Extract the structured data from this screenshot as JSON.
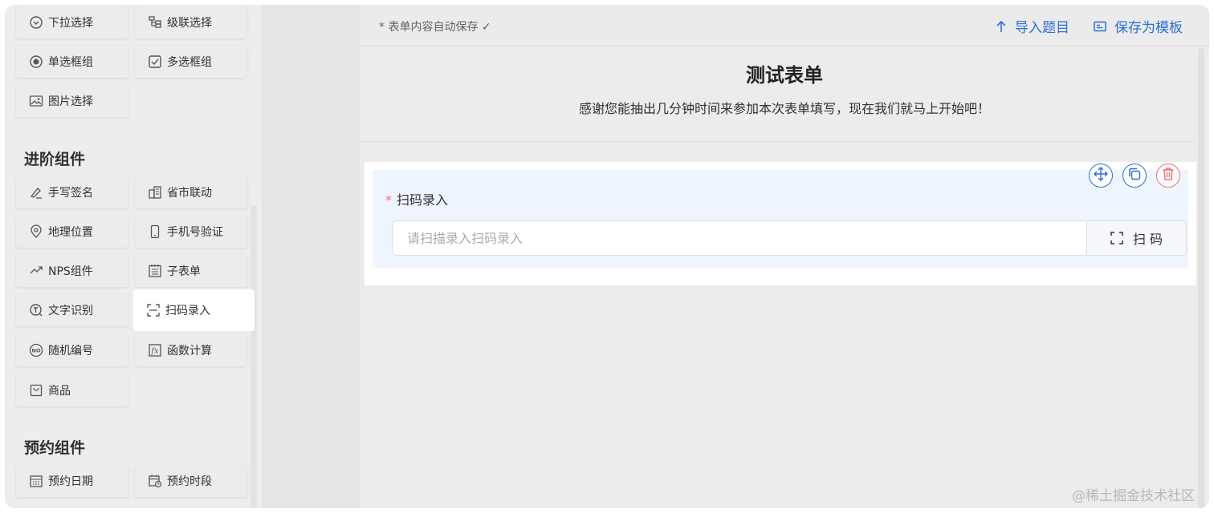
{
  "palette": {
    "basic_items": [
      {
        "label": "下拉选择",
        "icon": "dropdown-icon"
      },
      {
        "label": "级联选择",
        "icon": "cascade-icon"
      },
      {
        "label": "单选框组",
        "icon": "radio-icon"
      },
      {
        "label": "多选框组",
        "icon": "checkbox-icon"
      },
      {
        "label": "图片选择",
        "icon": "image-icon"
      }
    ],
    "advanced_title": "进阶组件",
    "advanced_items": [
      {
        "label": "手写签名",
        "icon": "signature-icon"
      },
      {
        "label": "省市联动",
        "icon": "building-icon"
      },
      {
        "label": "地理位置",
        "icon": "location-icon"
      },
      {
        "label": "手机号验证",
        "icon": "phone-icon"
      },
      {
        "label": "NPS组件",
        "icon": "nps-icon"
      },
      {
        "label": "子表单",
        "icon": "subform-icon"
      },
      {
        "label": "文字识别",
        "icon": "ocr-icon"
      },
      {
        "label": "扫码录入",
        "icon": "scan-icon"
      },
      {
        "label": "随机编号",
        "icon": "random-number-icon"
      },
      {
        "label": "函数计算",
        "icon": "function-icon"
      },
      {
        "label": "商品",
        "icon": "goods-icon"
      }
    ],
    "booking_title": "预约组件",
    "booking_items": [
      {
        "label": "预约日期",
        "icon": "calendar-icon"
      },
      {
        "label": "预约时段",
        "icon": "calendar-time-icon"
      }
    ]
  },
  "toolbar": {
    "autosave": "* 表单内容自动保存 ✓",
    "import_label": "导入题目",
    "save_template_label": "保存为模板"
  },
  "form": {
    "title": "测试表单",
    "description": "感谢您能抽出几分钟时间来参加本次表单填写，现在我们就马上开始吧！"
  },
  "field": {
    "required_mark": "*",
    "label": "扫码录入",
    "placeholder": "请扫描录入扫码录入",
    "button_label": "扫 码"
  },
  "watermark": "@稀土掘金技术社区",
  "colors": {
    "accent": "#2b6fd6",
    "danger": "#f56c6c",
    "field_bg": "#eef5fe"
  }
}
